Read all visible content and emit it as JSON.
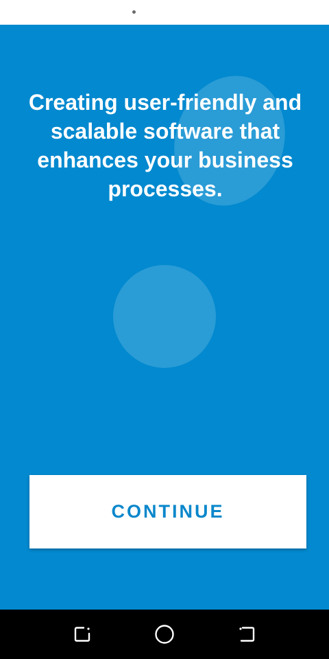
{
  "onboarding": {
    "headline": "Creating user-friendly and scalable software that enhances your business processes.",
    "continue_label": "CONTINUE"
  },
  "colors": {
    "background": "#0289cf",
    "button_text": "#0a87cb",
    "button_background": "#ffffff",
    "nav_bar": "#000000"
  },
  "nav_bar": {
    "icons": [
      "recent-apps-icon",
      "home-icon",
      "back-icon"
    ]
  }
}
